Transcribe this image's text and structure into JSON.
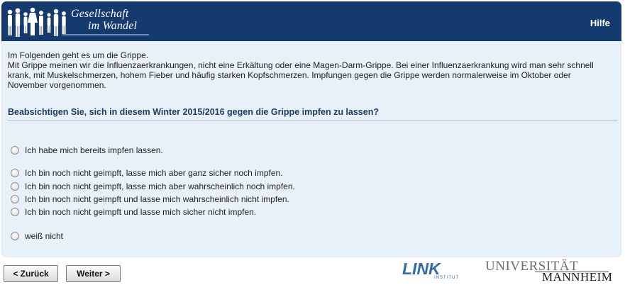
{
  "header": {
    "logo_line1": "Gesellschaft",
    "logo_line2": "im Wandel",
    "help_label": "Hilfe",
    "background_color": "#143a6e"
  },
  "intro": {
    "line1": "Im Folgenden geht es um die Grippe.",
    "line2": "Mit Grippe meinen wir die Influenzaerkrankungen, nicht eine Erkältung oder eine Magen-Darm-Grippe. Bei einer Influenzaerkrankung wird man sehr schnell krank, mit Muskelschmerzen, hohem Fieber und häufig starken Kopfschmerzen. Impfungen gegen die Grippe werden normalerweise im Oktober oder November vorgenommen."
  },
  "question": {
    "text": "Beabsichtigen Sie, sich in diesem Winter 2015/2016 gegen die Grippe impfen zu lassen?",
    "options": [
      {
        "label": "Ich habe mich bereits impfen lassen.",
        "selected": false
      },
      {
        "label": "Ich bin noch nicht geimpft, lasse mich aber ganz sicher noch impfen.",
        "selected": false
      },
      {
        "label": "Ich bin noch nicht geimpft, lasse mich aber wahrscheinlich noch impfen.",
        "selected": false
      },
      {
        "label": "Ich bin noch nicht geimpft und lasse mich wahrscheinlich nicht impfen.",
        "selected": false
      },
      {
        "label": "Ich bin noch nicht geimpft und lasse mich sicher nicht impfen.",
        "selected": false
      },
      {
        "label": "weiß nicht",
        "selected": false
      }
    ]
  },
  "nav": {
    "back_label": "< Zurück",
    "next_label": "Weiter >"
  },
  "footer_logos": {
    "link_word": "LINK",
    "link_sub": "INSTITUT",
    "uni_top": "UNIVERSITÄT",
    "uni_bottom": "MANNHEIM"
  },
  "colors": {
    "content_background": "#e8f0fa",
    "question_color": "#1c3d66",
    "link_blue": "#2f6bb0"
  }
}
